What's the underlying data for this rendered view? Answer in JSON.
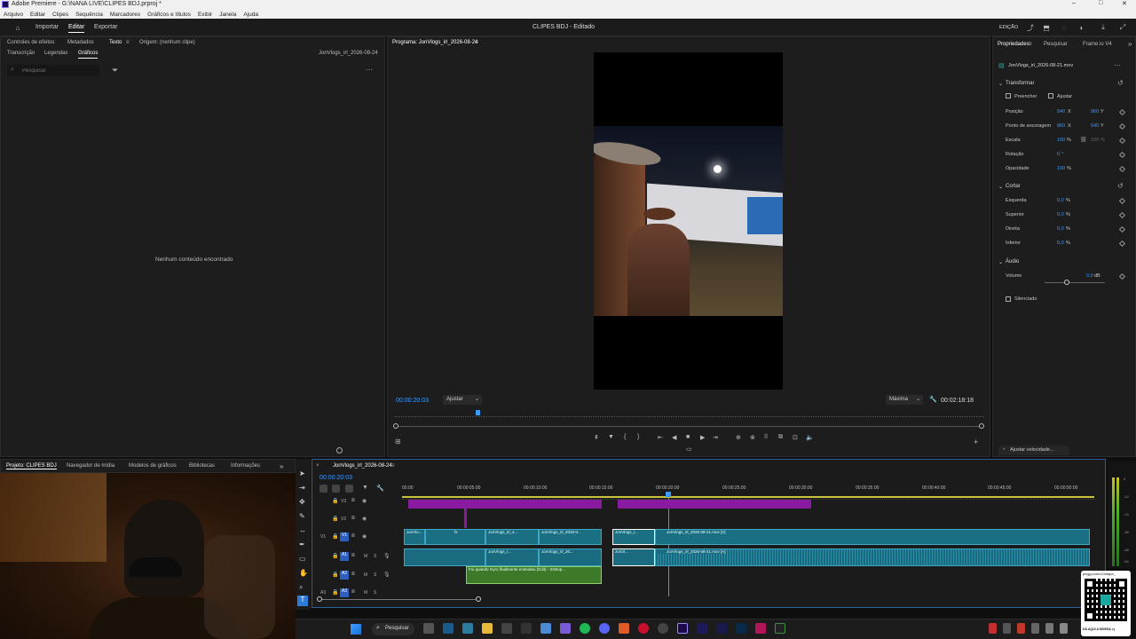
{
  "window": {
    "title": "Adobe Premiere - G:\\NANA LIVE\\CLIPES BDJ.prproj *",
    "controls": {
      "minimize": "–",
      "maximize": "□",
      "close": "✕"
    }
  },
  "menu": [
    "Arquivo",
    "Editar",
    "Clipes",
    "Sequência",
    "Marcadores",
    "Gráficos e títulos",
    "Exibir",
    "Janela",
    "Ajuda"
  ],
  "workspace": {
    "tabs": [
      "Importar",
      "Editar",
      "Exportar"
    ],
    "active": "Editar",
    "center_title": "CLIPES BDJ - Editado",
    "right_label": "EDIÇÃO"
  },
  "left_panel": {
    "tabs_row1": [
      "Controles de efeitos",
      "Metadados",
      "Texto",
      "Origem: (nenhum clipe)"
    ],
    "tabs_row2": [
      "Transcrição",
      "Legendas",
      "Gráficos"
    ],
    "sequence_name": "JonVlogs_irl_2026-08-24",
    "search_placeholder": "Pesquisar",
    "empty_message": "Nenhum conteúdo encontrado"
  },
  "program_monitor": {
    "title": "Programa: JonVlogs_irl_2026-08-24",
    "timecode": "00:00:20:03",
    "fit_label": "Ajustar",
    "quality_label": "Máxima",
    "duration": "00:02:18:18",
    "playhead_fraction": 0.14
  },
  "properties_panel": {
    "tabs": [
      "Propriedades",
      "Pesquisar",
      "Frame.io V4"
    ],
    "clip_name": "JonVlogs_irl_2026-08-21.mov",
    "transform_title": "Transformar",
    "fill_label": "Preencher",
    "fit_label": "Ajustar",
    "rows": [
      {
        "label": "Posição",
        "v1": "540",
        "u1": "X",
        "v2": "960",
        "u2": "Y"
      },
      {
        "label": "Ponto de ancoragem",
        "v1": "960",
        "u1": "X",
        "v2": "540",
        "u2": "Y"
      },
      {
        "label": "Escala",
        "v1": "100",
        "u1": "%",
        "v2": "100",
        "u2": "%"
      },
      {
        "label": "Rotação",
        "v1": "0",
        "u1": "°",
        "v2": "",
        "u2": ""
      },
      {
        "label": "Opacidade",
        "v1": "100",
        "u1": "%",
        "v2": "",
        "u2": ""
      }
    ],
    "crop_title": "Cortar",
    "crop_rows": [
      {
        "label": "Esquerda",
        "value": "0,0",
        "unit": "%"
      },
      {
        "label": "Superior",
        "value": "0,0",
        "unit": "%"
      },
      {
        "label": "Direita",
        "value": "0,0",
        "unit": "%"
      },
      {
        "label": "Inferior",
        "value": "0,0",
        "unit": "%"
      }
    ],
    "audio_title": "Áudio",
    "volume_label": "Volume",
    "volume_value": "0,0",
    "volume_unit": "dB",
    "mute_label": "Silenciado",
    "speed_button": "Ajustar velocidade..."
  },
  "project_panel": {
    "tabs": [
      "Projeto: CLIPES BDJ",
      "Navegador de mídia",
      "Modelos de gráficos",
      "Bibliotecas",
      "Informações"
    ]
  },
  "timeline": {
    "sequence_tab": "JonVlogs_irl_2026-08-24",
    "timecode": "00:00:20:03",
    "ruler": [
      "00:00",
      "00:00:05:00",
      "00:00:10:00",
      "00:00:15:00",
      "00:00:20:00",
      "00:00:25:00",
      "00:00:30:00",
      "00:00:35:00",
      "00:00:40:00",
      "00:00:45:00",
      "00:00:50:00"
    ],
    "tracks": [
      {
        "id": "V3",
        "name": "V3"
      },
      {
        "id": "V2",
        "name": "V2"
      },
      {
        "id": "V1",
        "name": "V1",
        "active_label": "V1"
      },
      {
        "id": "A1",
        "name": "A1",
        "active_label": "A1"
      },
      {
        "id": "A2",
        "name": "A2",
        "active_label": "A2"
      },
      {
        "id": "A3",
        "name": "A3"
      }
    ],
    "track_buttons": {
      "mute": "M",
      "solo": "S"
    },
    "clips": {
      "v1a": "JonVlo...",
      "v1b": "JonVlogs_irl_2...",
      "v1c": "JonVlogs_irl_2026-0...",
      "v1d": "JonVlogs_i...",
      "v1e": "JonVlogs_irl_2026-08-21.mov [V]",
      "a1a": "JonVlogs_i...",
      "a1b": "JonVlogs_irl_20...",
      "a1c": "JonVl...",
      "a1d": "JonVlogs_irl_2026-08-21.mov [A]",
      "a2": "Foi quando Gyro finalmente entendeu (Edit) - SrWup..."
    },
    "fx_label": "fx"
  },
  "meter_scale": [
    "0",
    "-12",
    "-24",
    "-36",
    "-48",
    "-54"
  ],
  "qr_overlay": {
    "url": "pixgg.com/o/Jotape_",
    "caption": "DÁ AQUI A MOEDA =)"
  },
  "taskbar": {
    "search_label": "Pesquisar"
  },
  "colors": {
    "accent": "#3d9bff",
    "video_clip": "#1b6f83",
    "purple_bar": "#8a1aa0",
    "audio_green": "#3c7a2a"
  }
}
